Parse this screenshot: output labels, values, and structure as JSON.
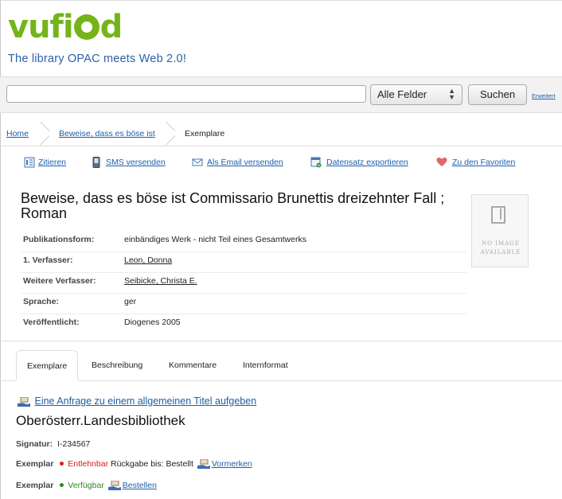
{
  "header": {
    "logo_prefix": "vufi",
    "logo_suffix": "d",
    "tagline": "The library OPAC meets Web 2.0!"
  },
  "search": {
    "query": "",
    "placeholder": "",
    "field_selected": "Alle Felder",
    "button": "Suchen",
    "advanced": "Erweitert"
  },
  "breadcrumb": {
    "home": "Home",
    "record": "Beweise, dass es böse ist",
    "current": "Exemplare"
  },
  "toolbar": {
    "cite": "Zitieren",
    "sms": "SMS versenden",
    "email": "Als Email versenden",
    "export": "Datensatz exportieren",
    "favorites": "Zu den Favoriten"
  },
  "record": {
    "title": "Beweise, dass es böse ist Commissario Brunettis dreizehnter Fall ; Roman",
    "fields": [
      {
        "label": "Publikationsform:",
        "value": "einbändiges Werk - nicht Teil eines Gesamtwerks",
        "link": false
      },
      {
        "label": "1. Verfasser:",
        "value": "Leon, Donna",
        "link": true
      },
      {
        "label": "Weitere Verfasser:",
        "value": "Seibicke, Christa E.",
        "link": true
      },
      {
        "label": "Sprache:",
        "value": "ger",
        "link": false
      },
      {
        "label": "Veröffentlicht:",
        "value": "Diogenes 2005",
        "link": false
      }
    ],
    "noimage_line1": "NO IMAGE",
    "noimage_line2": "AVAILABLE"
  },
  "tabs": [
    "Exemplare",
    "Beschreibung",
    "Kommentare",
    "Internformat"
  ],
  "holdings": {
    "request_link": "Eine Anfrage zu einem allgemeinen Titel aufgeben",
    "library": "Oberösterr.Landesbibliothek",
    "signature_label": "Signatur:",
    "signature": "I-234567",
    "items": [
      {
        "label": "Exemplar",
        "status": "Entlehnbar",
        "status_color": "#d21e1e",
        "note": "Rückgabe bis: Bestellt",
        "action": "Vormerken"
      },
      {
        "label": "Exemplar",
        "status": "Verfügbar",
        "status_color": "#2f8a1f",
        "note": "",
        "action": "Bestellen"
      }
    ]
  }
}
